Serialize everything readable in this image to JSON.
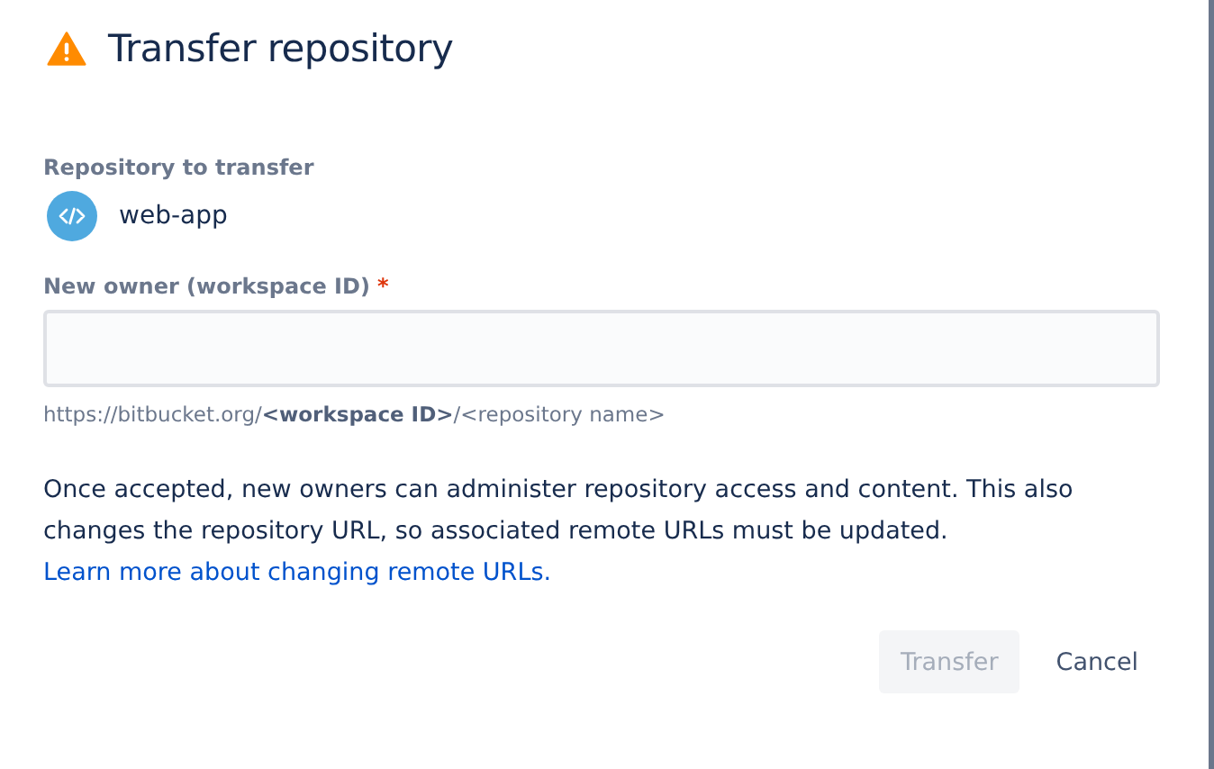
{
  "dialog": {
    "title": "Transfer repository"
  },
  "repository": {
    "label": "Repository to transfer",
    "name": "web-app"
  },
  "owner_field": {
    "label": "New owner (workspace ID)",
    "required_mark": "*",
    "required": true,
    "hint": "https://bitbucket.org/**<workspace ID>**/<repository name>"
  },
  "notice": {
    "text": "Once accepted, new owners can administer repository access and content. This also changes the repository URL, so associated remote URLs must be updated.",
    "link": "Learn more about changing remote URLs."
  },
  "buttons": [
    {
      "label": "Transfer",
      "kind": "primary",
      "disabled": true
    },
    {
      "label": "Cancel",
      "kind": "subtle",
      "disabled": false
    }
  ]
}
